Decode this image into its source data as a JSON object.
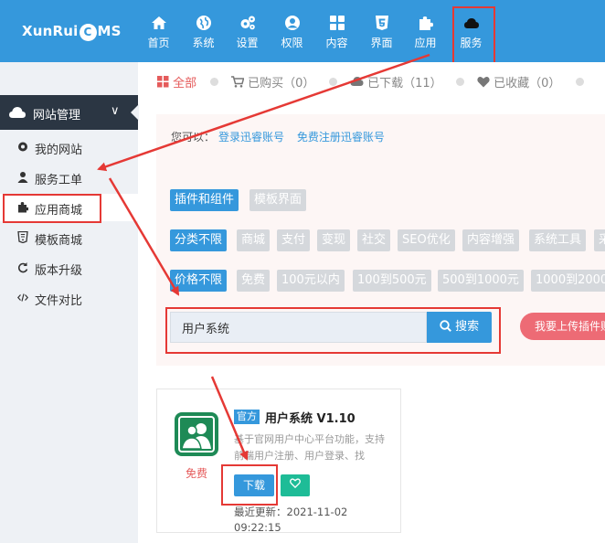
{
  "logo": {
    "before": "XunRui",
    "c": "C",
    "after": "MS"
  },
  "nav": [
    {
      "label": "首页",
      "icon": "home-icon"
    },
    {
      "label": "系统",
      "icon": "globe-icon"
    },
    {
      "label": "设置",
      "icon": "gears-icon"
    },
    {
      "label": "权限",
      "icon": "user-circle-icon"
    },
    {
      "label": "内容",
      "icon": "grid-icon"
    },
    {
      "label": "界面",
      "icon": "html5-icon"
    },
    {
      "label": "应用",
      "icon": "puzzle-icon"
    },
    {
      "label": "服务",
      "icon": "cloud-icon"
    }
  ],
  "sidebar": {
    "section_title": "网站管理",
    "items": [
      {
        "label": "我的网站",
        "icon": "gear-icon"
      },
      {
        "label": "服务工单",
        "icon": "user-icon"
      },
      {
        "label": "应用商城",
        "icon": "puzzle-icon"
      },
      {
        "label": "模板商城",
        "icon": "html5-icon"
      },
      {
        "label": "版本升级",
        "icon": "refresh-icon"
      },
      {
        "label": "文件对比",
        "icon": "code-icon"
      }
    ]
  },
  "tabs": {
    "all": "全部",
    "bought": "已购买（0）",
    "downloaded": "已下载（11）",
    "favorited": "已收藏（0）"
  },
  "login_hint": {
    "prefix": "您可以：",
    "login_link": "登录迅睿账号",
    "register_link": "免费注册迅睿账号"
  },
  "filters": {
    "type": [
      "插件和组件",
      "模板界面"
    ],
    "category": [
      "分类不限",
      "商城",
      "支付",
      "变现",
      "社交",
      "SEO优化",
      "内容增强",
      "系统工具",
      "采"
    ],
    "price": [
      "价格不限",
      "免费",
      "100元以内",
      "100到500元",
      "500到1000元",
      "1000到2000"
    ]
  },
  "search": {
    "value": "用户系统",
    "button": "搜索"
  },
  "upload_button": "我要上传插件赚",
  "product": {
    "badge": "官方",
    "title": "用户系统 V1.10",
    "description": "基于官网用户中心平台功能，支持前端用户注册、用户登录、找",
    "price": "免费",
    "download": "下载",
    "updated": "最近更新：2021-11-02 09:22:15"
  },
  "colors": {
    "topbar": "#3598dc",
    "accent_red": "#e55b5b",
    "annotation": "#e53935",
    "fav": "#1ebc97"
  }
}
